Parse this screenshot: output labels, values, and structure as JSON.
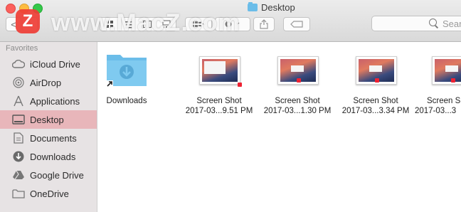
{
  "window": {
    "title": "Desktop"
  },
  "toolbar": {
    "back_label": "<",
    "search_placeholder": "Sear"
  },
  "watermark": {
    "logo_letter": "Z",
    "text": "www.MacZ.com"
  },
  "sidebar": {
    "heading": "Favorites",
    "items": [
      {
        "label": "iCloud Drive",
        "icon": "cloud-icon"
      },
      {
        "label": "AirDrop",
        "icon": "airdrop-icon"
      },
      {
        "label": "Applications",
        "icon": "applications-icon"
      },
      {
        "label": "Desktop",
        "icon": "desktop-icon",
        "selected": true
      },
      {
        "label": "Documents",
        "icon": "documents-icon"
      },
      {
        "label": "Downloads",
        "icon": "downloads-icon"
      },
      {
        "label": "Google Drive",
        "icon": "google-drive-icon"
      },
      {
        "label": "OneDrive",
        "icon": "folder-icon"
      }
    ]
  },
  "files": [
    {
      "line1": "Downloads",
      "line2": "",
      "kind": "folder-alias"
    },
    {
      "line1": "Screen Shot",
      "line2": "2017-03...9.51 PM",
      "kind": "screenshot"
    },
    {
      "line1": "Screen Shot",
      "line2": "2017-03...1.30 PM",
      "kind": "screenshot"
    },
    {
      "line1": "Screen Shot",
      "line2": "2017-03...3.34 PM",
      "kind": "screenshot"
    },
    {
      "line1": "Screen S",
      "line2": "2017-03...3",
      "kind": "screenshot"
    }
  ],
  "colors": {
    "selected_row": "#e8b6ba",
    "sidebar_bg": "#e7e3e4",
    "folder_blue": "#6bbde9"
  }
}
